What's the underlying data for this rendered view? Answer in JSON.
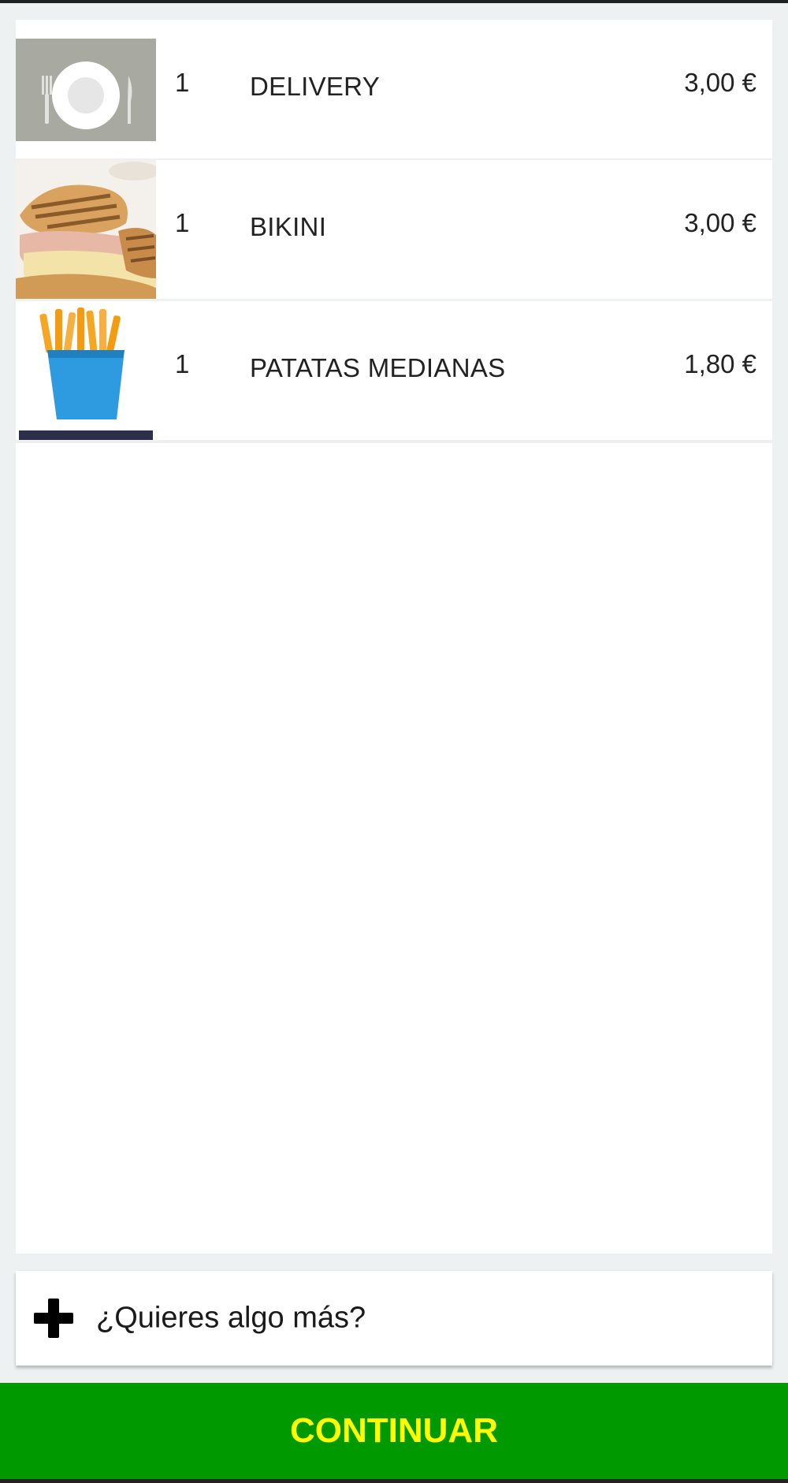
{
  "cart": {
    "items": [
      {
        "quantity": "1",
        "name": "DELIVERY",
        "price": "3,00 €",
        "image_icon": "plate-cutlery-icon"
      },
      {
        "quantity": "1",
        "name": "BIKINI",
        "price": "3,00 €",
        "image_icon": "sandwich-photo"
      },
      {
        "quantity": "1",
        "name": "PATATAS MEDIANAS",
        "price": "1,80 €",
        "image_icon": "fries-icon"
      }
    ]
  },
  "add_more": {
    "label": "¿Quieres algo más?",
    "icon": "plus-icon"
  },
  "continue_button": {
    "label": "CONTINUAR"
  },
  "colors": {
    "background": "#edf1f2",
    "accent": "#009a00",
    "accent_text": "#ffff00",
    "text": "#222222"
  }
}
